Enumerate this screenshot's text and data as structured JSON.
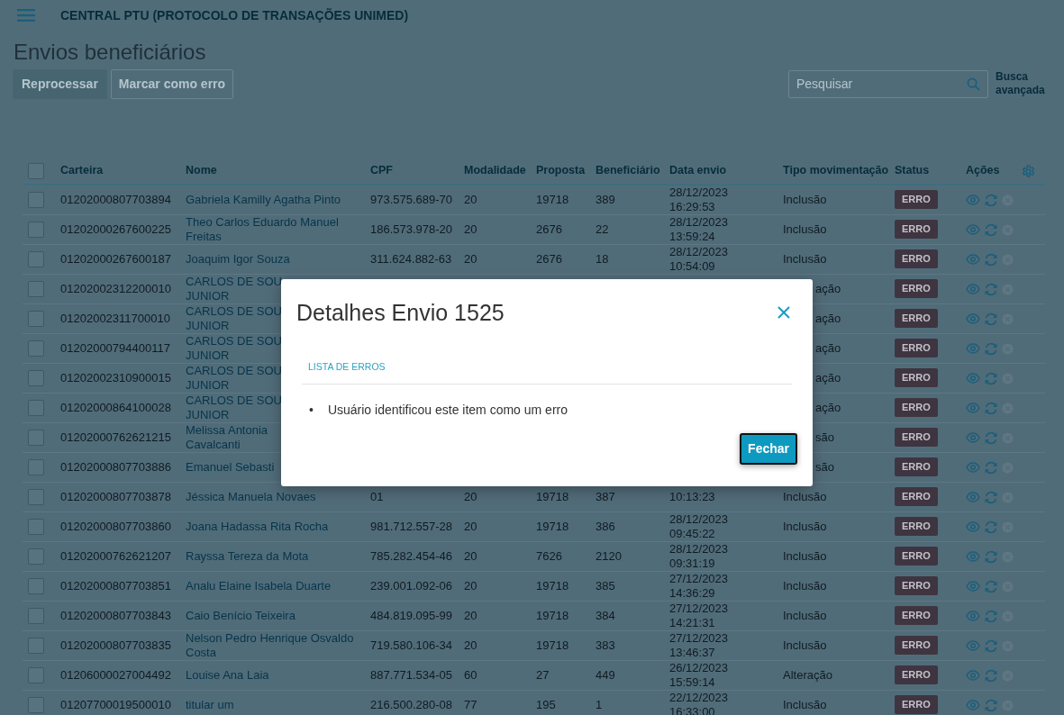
{
  "app_bar": {
    "title": "CENTRAL PTU (PROTOCOLO DE TRANSAÇÕES UNIMED)"
  },
  "page_title": "Envios beneficiários",
  "toolbar": {
    "buttons": [
      {
        "label": "Reprocessar",
        "kind": "filled",
        "disabled": true
      },
      {
        "label": "Marcar como erro",
        "kind": "outline",
        "disabled": true
      }
    ],
    "search": {
      "placeholder": "Pesquisar"
    },
    "advanced_link": "Busca avançada"
  },
  "table": {
    "select_all_checked": false,
    "columns": [
      "Carteira",
      "Nome",
      "CPF",
      "Modalidade",
      "Proposta",
      "Beneficiário",
      "Data envio",
      "Tipo movimentação",
      "Status",
      "Ações"
    ],
    "rows": [
      {
        "checked": false,
        "carteira": "01202000807703894",
        "nome": "Gabriela Kamilly Agatha Pinto",
        "cpf": "973.575.689-70",
        "modalidade": "20",
        "proposta": "19718",
        "beneficiario": "389",
        "data": "28/12/2023 16:29:53",
        "tipo": "Inclusão",
        "status": "ERRO",
        "cancel_disabled": true
      },
      {
        "checked": false,
        "carteira": "01202000267600225",
        "nome": "Theo Carlos Eduardo Manuel Freitas",
        "cpf": "186.573.978-20",
        "modalidade": "20",
        "proposta": "2676",
        "beneficiario": "22",
        "data": "28/12/2023 13:59:24",
        "tipo": "Inclusão",
        "status": "ERRO",
        "cancel_disabled": true
      },
      {
        "checked": false,
        "carteira": "01202000267600187",
        "nome": "Joaquim Igor Souza",
        "cpf": "311.624.882-63",
        "modalidade": "20",
        "proposta": "2676",
        "beneficiario": "18",
        "data": "28/12/2023 10:54:09",
        "tipo": "Inclusão",
        "status": "ERRO",
        "cancel_disabled": true
      },
      {
        "checked": false,
        "covered": true,
        "carteira": "01202002312200010",
        "nome": [
          "CARLOS DE SOU",
          "JUNIOR"
        ],
        "tipo": "ação",
        "status": "ERRO",
        "cancel_disabled": true
      },
      {
        "checked": false,
        "covered": true,
        "carteira": "01202002311700010",
        "nome": [
          "CARLOS DE SOU",
          "JUNIOR"
        ],
        "tipo": "ação",
        "status": "ERRO",
        "cancel_disabled": true
      },
      {
        "checked": false,
        "covered": true,
        "carteira": "01202000794400117",
        "nome": [
          "CARLOS DE SOU",
          "JUNIOR"
        ],
        "tipo": "ação",
        "status": "ERRO",
        "cancel_disabled": true
      },
      {
        "checked": false,
        "covered": true,
        "carteira": "01202002310900015",
        "nome": [
          "CARLOS DE SOU",
          "JUNIOR"
        ],
        "tipo": "ação",
        "status": "ERRO",
        "cancel_disabled": true
      },
      {
        "checked": false,
        "covered": true,
        "carteira": "01202000864100028",
        "nome": [
          "CARLOS DE SOU",
          "JUNIOR"
        ],
        "tipo": "ação",
        "status": "ERRO",
        "cancel_disabled": true
      },
      {
        "checked": false,
        "covered": true,
        "carteira": "01202000762621215",
        "nome": [
          "Melissa Antonia",
          "Cavalcanti"
        ],
        "tipo": "são",
        "status": "ERRO",
        "cancel_disabled": true
      },
      {
        "checked": false,
        "covered": true,
        "carteira": "01202000807703886",
        "nome": [
          "Emanuel Sebasti"
        ],
        "tipo": "são",
        "status": "ERRO",
        "cancel_disabled": true
      },
      {
        "checked": false,
        "carteira": "01202000807703878",
        "nome": "Jéssica Manuela Novaes",
        "cpf": "01",
        "modalidade": "20",
        "proposta": "19718",
        "beneficiario": "387",
        "data": "10:13:23",
        "tipo": "Inclusão",
        "status": "ERRO",
        "cancel_disabled": true
      },
      {
        "checked": false,
        "carteira": "01202000807703860",
        "nome": "Joana Hadassa Rita Rocha",
        "cpf": "981.712.557-28",
        "modalidade": "20",
        "proposta": "19718",
        "beneficiario": "386",
        "data": "28/12/2023 09:45:22",
        "tipo": "Inclusão",
        "status": "ERRO",
        "cancel_disabled": true
      },
      {
        "checked": false,
        "carteira": "01202000762621207",
        "nome": "Rayssa Tereza da Mota",
        "cpf": "785.282.454-46",
        "modalidade": "20",
        "proposta": "7626",
        "beneficiario": "2120",
        "data": "28/12/2023 09:31:19",
        "tipo": "Inclusão",
        "status": "ERRO",
        "cancel_disabled": true
      },
      {
        "checked": false,
        "carteira": "01202000807703851",
        "nome": "Analu Elaine Isabela Duarte",
        "cpf": "239.001.092-06",
        "modalidade": "20",
        "proposta": "19718",
        "beneficiario": "385",
        "data": "27/12/2023 14:36:29",
        "tipo": "Inclusão",
        "status": "ERRO",
        "cancel_disabled": true
      },
      {
        "checked": false,
        "carteira": "01202000807703843",
        "nome": "Caio Benício Teixeira",
        "cpf": "484.819.095-99",
        "modalidade": "20",
        "proposta": "19718",
        "beneficiario": "384",
        "data": "27/12/2023 14:21:31",
        "tipo": "Inclusão",
        "status": "ERRO",
        "cancel_disabled": true
      },
      {
        "checked": false,
        "carteira": "01202000807703835",
        "nome": "Nelson Pedro Henrique Osvaldo Costa",
        "cpf": "719.580.106-34",
        "modalidade": "20",
        "proposta": "19718",
        "beneficiario": "383",
        "data": "27/12/2023 13:46:37",
        "tipo": "Inclusão",
        "status": "ERRO",
        "cancel_disabled": true
      },
      {
        "checked": false,
        "carteira": "01206000027004492",
        "nome": "Louise Ana Laia",
        "cpf": "887.771.534-05",
        "modalidade": "60",
        "proposta": "27",
        "beneficiario": "449",
        "data": "26/12/2023 15:59:14",
        "tipo": "Alteração",
        "status": "ERRO",
        "cancel_disabled": true
      },
      {
        "checked": false,
        "carteira": "01207700019500010",
        "nome": "titular um",
        "cpf": "216.500.280-08",
        "modalidade": "77",
        "proposta": "195",
        "beneficiario": "1",
        "data": "22/12/2023 16:33:00",
        "tipo": "Inclusão",
        "status": "ERRO",
        "cancel_disabled": true
      }
    ]
  },
  "dialog": {
    "title": "Detalhes Envio 1525",
    "section_title": "LISTA DE ERROS",
    "error_marker": "•",
    "errors": [
      "Usuário identificou este item como um erro"
    ],
    "close_button": "Fechar"
  }
}
